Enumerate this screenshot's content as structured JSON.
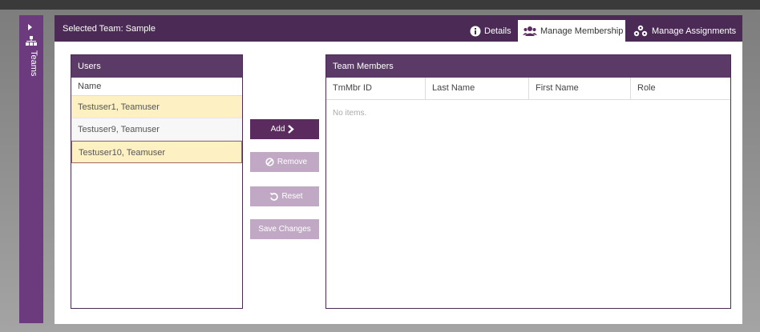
{
  "rail": {
    "label": "Teams"
  },
  "header": {
    "selected_team": "Selected Team: Sample",
    "tabs": [
      {
        "label": "Details",
        "icon": "info-icon"
      },
      {
        "label": "Manage Membership",
        "icon": "people-icon"
      },
      {
        "label": "Manage Assignments",
        "icon": "assignments-icon"
      }
    ],
    "active_tab": "Manage Membership"
  },
  "users": {
    "title": "Users",
    "column": "Name",
    "items": [
      "Testuser1, Teamuser",
      "Testuser9, Teamuser",
      "Testuser10, Teamuser"
    ]
  },
  "buttons": {
    "add": "Add",
    "remove": "Remove",
    "reset": "Reset",
    "save": "Save Changes"
  },
  "members": {
    "title": "Team Members",
    "columns": [
      "TmMbr ID",
      "Last Name",
      "First Name",
      "Role"
    ],
    "empty_text": "No items."
  },
  "colors": {
    "header_bg": "#4b2a56",
    "rail_bg": "#6b3b7d",
    "primary_button": "#5b2a5f",
    "disabled_button": "#c1a9c5",
    "highlight_row": "#fdf1c4"
  }
}
